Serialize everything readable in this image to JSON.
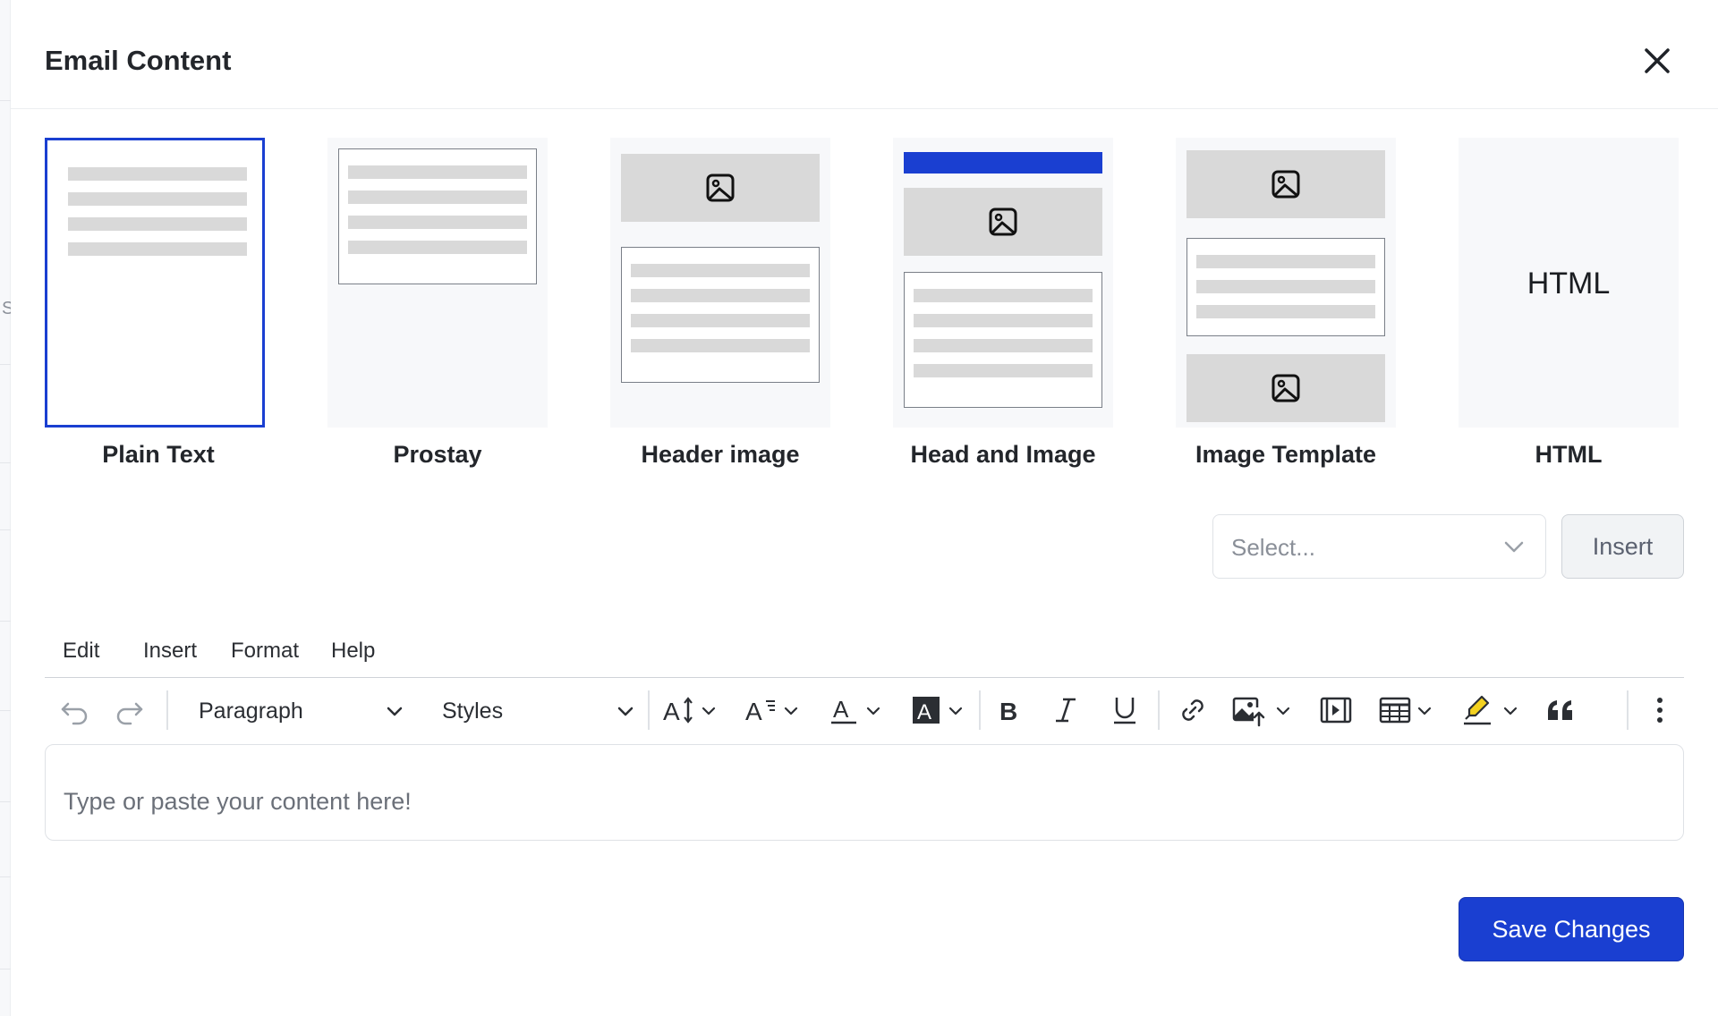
{
  "modal": {
    "title": "Email Content"
  },
  "templates": [
    {
      "label": "Plain Text",
      "selected": true
    },
    {
      "label": "Prostay"
    },
    {
      "label": "Header image"
    },
    {
      "label": "Head and Image"
    },
    {
      "label": "Image Template"
    },
    {
      "label": "HTML",
      "preview_text": "HTML"
    }
  ],
  "template_picker": {
    "placeholder": "Select...",
    "insert_label": "Insert"
  },
  "editor": {
    "menu": [
      "Edit",
      "Insert",
      "Format",
      "Help"
    ],
    "block_format": "Paragraph",
    "styles": "Styles",
    "placeholder": "Type or paste your content here!"
  },
  "footer": {
    "save_label": "Save Changes"
  },
  "background": {
    "letter": "S"
  },
  "colors": {
    "accent": "#1a3fd1",
    "placeholder_bar": "#d9d9d9",
    "card_bg": "#f7f8fa"
  }
}
